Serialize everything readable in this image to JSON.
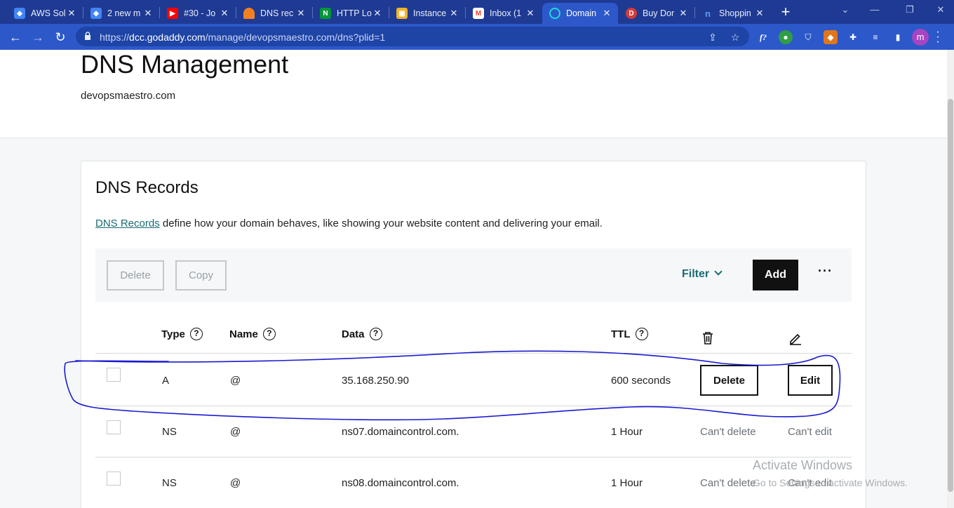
{
  "browser": {
    "tabs": [
      {
        "title": "AWS Sol",
        "icon": "google-cloud-icon",
        "color": "#4285f4"
      },
      {
        "title": "2 new m",
        "icon": "google-cloud-icon",
        "color": "#4285f4"
      },
      {
        "title": "#30 - Jo",
        "icon": "youtube-icon",
        "color": "#ff0000"
      },
      {
        "title": "DNS rec",
        "icon": "cloudflare-icon",
        "color": "#f38020"
      },
      {
        "title": "HTTP Lo",
        "icon": "nginx-icon",
        "color": "#009639"
      },
      {
        "title": "Instance",
        "icon": "aws-box-icon",
        "color": "#f0b429"
      },
      {
        "title": "Inbox (1",
        "icon": "gmail-icon",
        "color": "#ea4335"
      },
      {
        "title": "Domain",
        "icon": "godaddy-icon",
        "color": "#1bdbdb",
        "active": true
      },
      {
        "title": "Buy Dor",
        "icon": "dynadot-icon",
        "color": "#d63a3a"
      },
      {
        "title": "Shoppin",
        "icon": "namecheap-icon",
        "color": "#5aa0e8"
      }
    ],
    "url_prefix": "https://",
    "url_host": "dcc.godaddy.com",
    "url_path": "/manage/devopsmaestro.com/dns?plid=1",
    "profile_initial": "m"
  },
  "page": {
    "title": "DNS Management",
    "domain": "devopsmaestro.com"
  },
  "records": {
    "title": "DNS Records",
    "intro_link": "DNS Records",
    "intro_text": " define how your domain behaves, like showing your website content and delivering your email.",
    "actions": {
      "delete": "Delete",
      "copy": "Copy",
      "filter": "Filter",
      "add": "Add",
      "more": "···"
    },
    "columns": {
      "type": "Type",
      "name": "Name",
      "data": "Data",
      "ttl": "TTL"
    },
    "rows": [
      {
        "type": "A",
        "name": "@",
        "data": "35.168.250.90",
        "ttl": "600 seconds",
        "delete": "Delete",
        "edit": "Edit",
        "editable": true
      },
      {
        "type": "NS",
        "name": "@",
        "data": "ns07.domaincontrol.com.",
        "ttl": "1 Hour",
        "delete": "Can't delete",
        "edit": "Can't edit",
        "editable": false
      },
      {
        "type": "NS",
        "name": "@",
        "data": "ns08.domaincontrol.com.",
        "ttl": "1 Hour",
        "delete": "Can't delete",
        "edit": "Can't edit",
        "editable": false
      }
    ]
  },
  "watermark": {
    "line1": "Activate Windows",
    "line2": "Go to Settings to activate Windows."
  },
  "colors": {
    "annotation": "#1a1ad0",
    "accent": "#1a6a73",
    "chrome": "#2c58c9"
  }
}
